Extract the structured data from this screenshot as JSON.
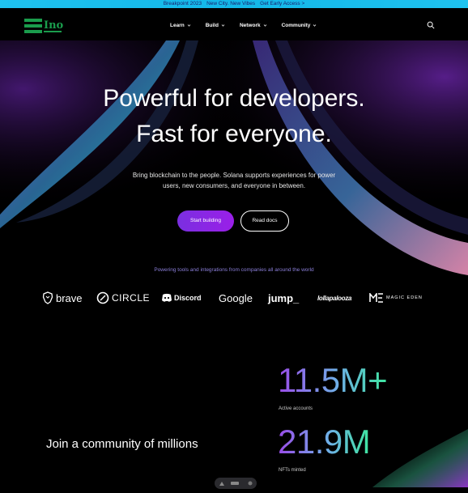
{
  "announcement": {
    "event": "Breakpoint 2023",
    "tagline": "New City. New Vibes",
    "cta": "Get Early Access",
    "arrow": ">"
  },
  "nav": {
    "logo_text": "Ino",
    "items": [
      {
        "label": "Learn"
      },
      {
        "label": "Build"
      },
      {
        "label": "Network"
      },
      {
        "label": "Community"
      }
    ],
    "search_icon": "search-icon"
  },
  "hero": {
    "line1": "Powerful for developers.",
    "line2": "Fast for everyone.",
    "subtitle": "Bring blockchain to the people. Solana supports experiences for power users, new consumers, and everyone in between.",
    "primary_cta": "Start building",
    "secondary_cta": "Read docs"
  },
  "partners": {
    "heading": "Powering tools and integrations from companies all around the world",
    "logos": [
      {
        "name": "brave"
      },
      {
        "name": "CIRCLE"
      },
      {
        "name": "Discord"
      },
      {
        "name": "Google"
      },
      {
        "name": "jump_"
      },
      {
        "name": "lollapalooza"
      },
      {
        "name": "MAGIC EDEN"
      }
    ]
  },
  "community": {
    "heading": "Join a community of millions",
    "stats": [
      {
        "value": "11.5M+",
        "label": "Active accounts"
      },
      {
        "value": "21.9M",
        "label": "NFTs minted"
      }
    ]
  },
  "colors": {
    "announcement_bg": "#13b7e8",
    "accent_purple": "#9945ff",
    "accent_green": "#14f195",
    "background": "#000000"
  }
}
